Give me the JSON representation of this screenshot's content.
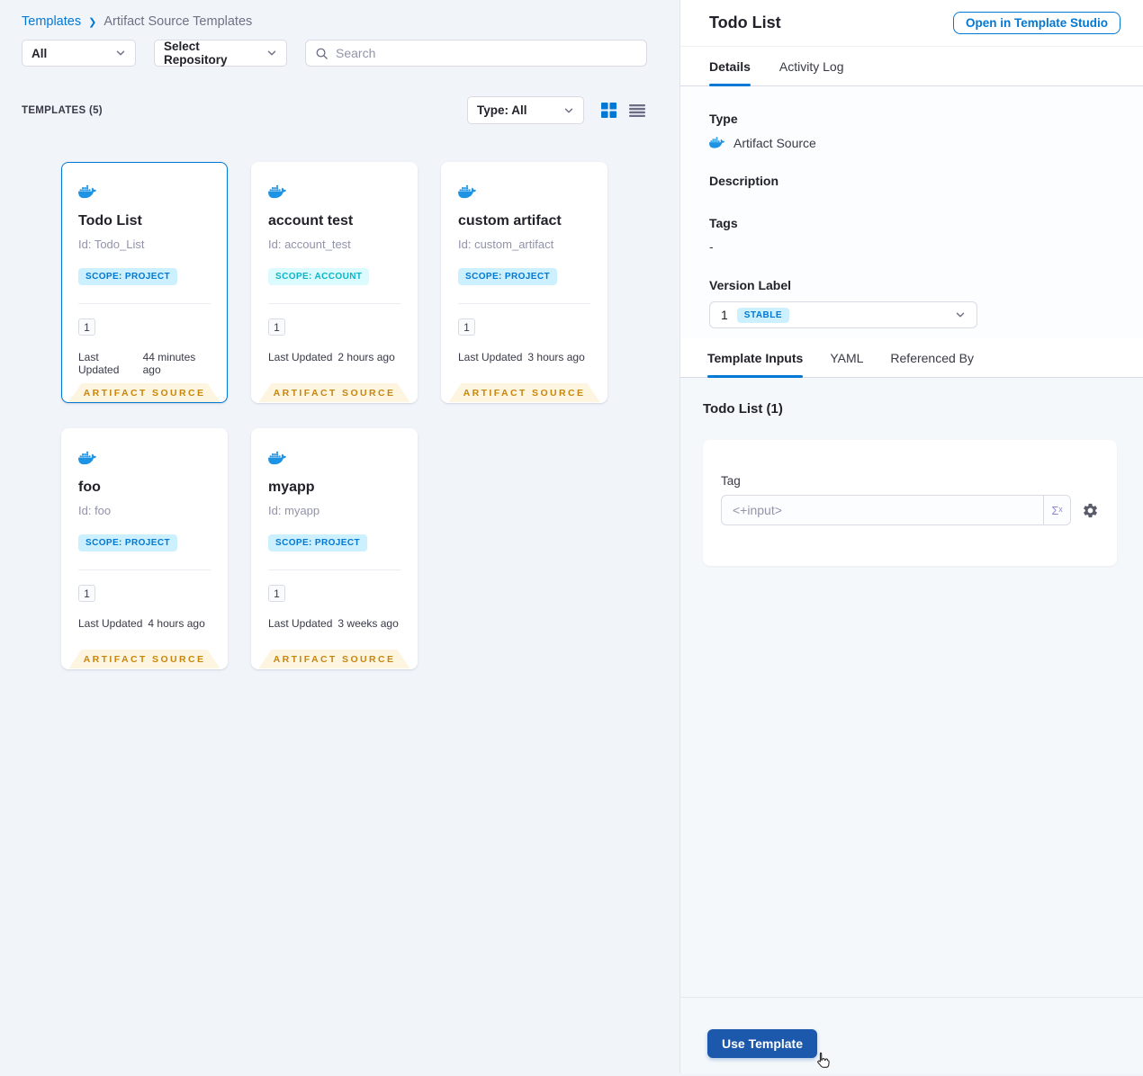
{
  "breadcrumb": {
    "root": "Templates",
    "separator": "❯",
    "current": "Artifact Source Templates"
  },
  "filters": {
    "scope_dropdown": "All",
    "repo_dropdown": "Select Repository",
    "search_placeholder": "Search",
    "type_dropdown": "Type: All"
  },
  "templates_header": {
    "label": "TEMPLATES (5)"
  },
  "cards": [
    {
      "title": "Todo List",
      "id": "Id: Todo_List",
      "scope": "SCOPE: PROJECT",
      "scope_type": "project",
      "version": "1",
      "updated_label": "Last Updated",
      "updated": "44 minutes ago",
      "badge": "ARTIFACT SOURCE",
      "selected": true
    },
    {
      "title": "account test",
      "id": "Id: account_test",
      "scope": "SCOPE: ACCOUNT",
      "scope_type": "account",
      "version": "1",
      "updated_label": "Last Updated",
      "updated": "2 hours ago",
      "badge": "ARTIFACT SOURCE",
      "selected": false
    },
    {
      "title": "custom artifact",
      "id": "Id: custom_artifact",
      "scope": "SCOPE: PROJECT",
      "scope_type": "project",
      "version": "1",
      "updated_label": "Last Updated",
      "updated": "3 hours ago",
      "badge": "ARTIFACT SOURCE",
      "selected": false
    },
    {
      "title": "foo",
      "id": "Id: foo",
      "scope": "SCOPE: PROJECT",
      "scope_type": "project",
      "version": "1",
      "updated_label": "Last Updated",
      "updated": "4 hours ago",
      "badge": "ARTIFACT SOURCE",
      "selected": false
    },
    {
      "title": "myapp",
      "id": "Id: myapp",
      "scope": "SCOPE: PROJECT",
      "scope_type": "project",
      "version": "1",
      "updated_label": "Last Updated",
      "updated": "3 weeks ago",
      "badge": "ARTIFACT SOURCE",
      "selected": false
    }
  ],
  "panel": {
    "title": "Todo List",
    "open_button": "Open in Template Studio",
    "tabs": [
      {
        "label": "Details"
      },
      {
        "label": "Activity Log"
      }
    ],
    "details": {
      "type_label": "Type",
      "type_value": "Artifact Source",
      "description_label": "Description",
      "tags_label": "Tags",
      "tags_value": "-",
      "version_label": "Version Label",
      "version_value": "1",
      "version_badge": "STABLE"
    },
    "inner_tabs": [
      {
        "label": "Template Inputs"
      },
      {
        "label": "YAML"
      },
      {
        "label": "Referenced By"
      }
    ],
    "inputs": {
      "heading": "Todo List (1)",
      "tag_label": "Tag",
      "tag_placeholder": "<+input>",
      "expression_symbol": "Σˣ"
    },
    "use_button": "Use Template"
  },
  "icons": {
    "docker": "docker-whale",
    "search": "magnifier",
    "chevron": "chevron-down",
    "grid": "grid-view",
    "list": "list-view",
    "gear": "settings-gear",
    "cursor": "hand-pointer"
  },
  "colors": {
    "accent_blue": "#0278d5",
    "docker_blue": "#1e93e3",
    "badge_project_bg": "#cdf0fe",
    "badge_account_bg": "#dcfbfe",
    "badge_account_text": "#0ab5c9",
    "ribbon_bg": "#fdf5df",
    "ribbon_text": "#c7860f",
    "use_button_bg": "#1c58ab"
  }
}
